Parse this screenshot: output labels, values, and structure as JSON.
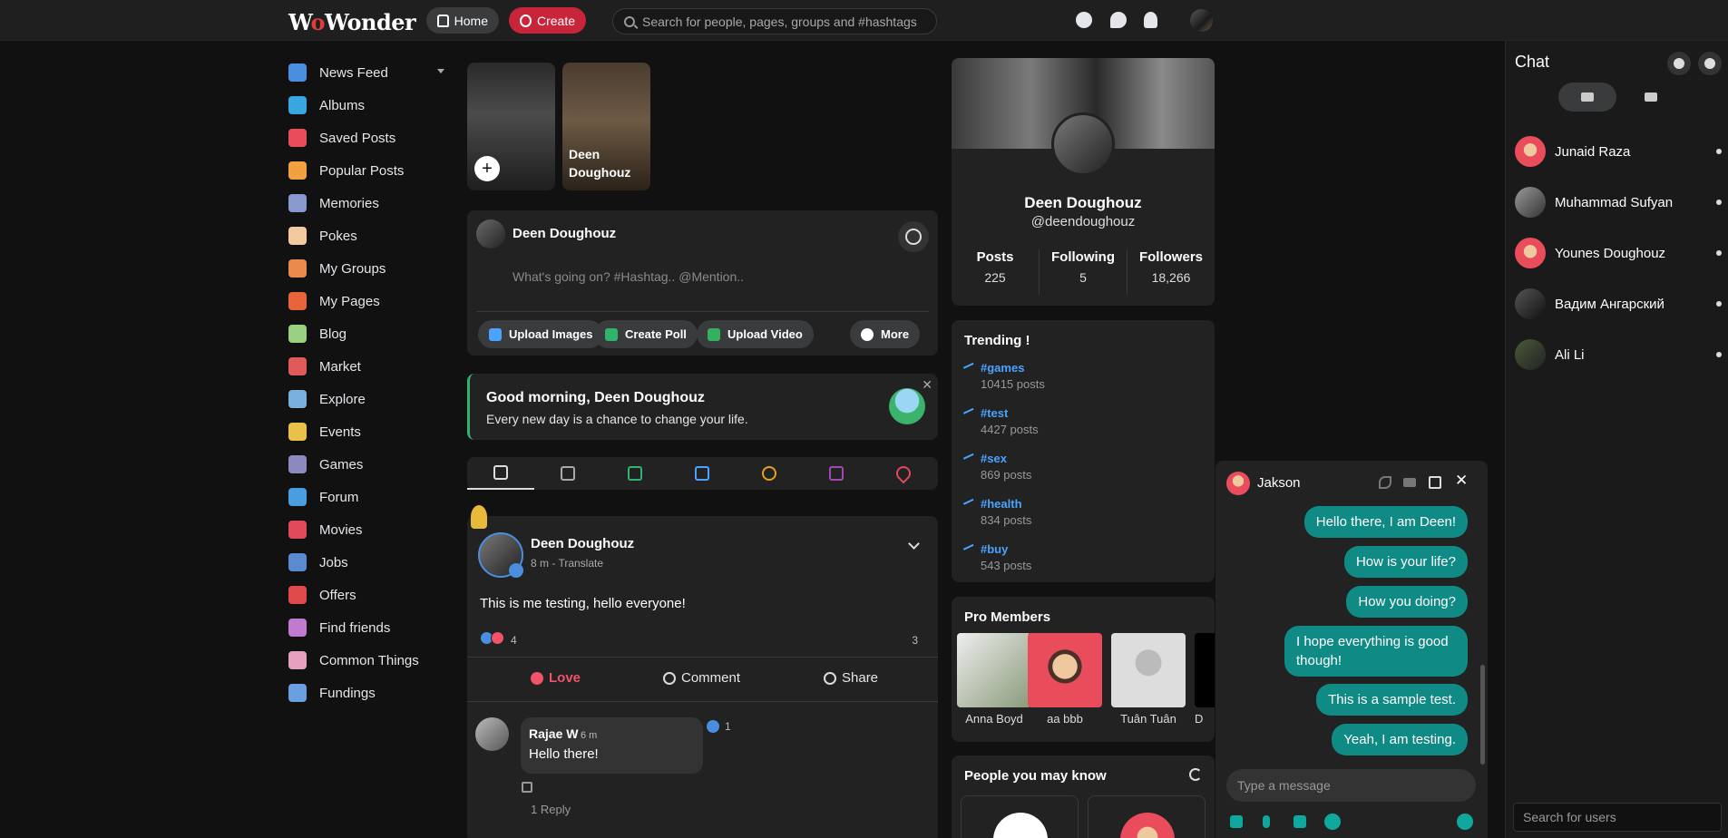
{
  "header": {
    "logo": "WoWonder",
    "home_label": "Home",
    "create_label": "Create",
    "search_placeholder": "Search for people, pages, groups and #hashtags"
  },
  "nav": {
    "items": [
      {
        "label": "News Feed",
        "icon": "home-icon",
        "color": "#4a8ee0"
      },
      {
        "label": "Albums",
        "icon": "albums-icon",
        "color": "#3aa6e0"
      },
      {
        "label": "Saved Posts",
        "icon": "bookmark-icon",
        "color": "#e94d5c"
      },
      {
        "label": "Popular Posts",
        "icon": "fire-icon",
        "color": "#f0a040"
      },
      {
        "label": "Memories",
        "icon": "memories-icon",
        "color": "#8a9ad0"
      },
      {
        "label": "Pokes",
        "icon": "poke-icon",
        "color": "#f3c9a0"
      },
      {
        "label": "My Groups",
        "icon": "groups-icon",
        "color": "#e88a4a"
      },
      {
        "label": "My Pages",
        "icon": "flag-icon",
        "color": "#e8643a"
      },
      {
        "label": "Blog",
        "icon": "blog-icon",
        "color": "#9ad080"
      },
      {
        "label": "Market",
        "icon": "market-icon",
        "color": "#e05a5a"
      },
      {
        "label": "Explore",
        "icon": "explore-icon",
        "color": "#7ab0e0"
      },
      {
        "label": "Events",
        "icon": "events-icon",
        "color": "#e8c04a"
      },
      {
        "label": "Games",
        "icon": "games-icon",
        "color": "#8a8ac0"
      },
      {
        "label": "Forum",
        "icon": "forum-icon",
        "color": "#4a9ee0"
      },
      {
        "label": "Movies",
        "icon": "movies-icon",
        "color": "#e04a5a"
      },
      {
        "label": "Jobs",
        "icon": "jobs-icon",
        "color": "#5a8ad0"
      },
      {
        "label": "Offers",
        "icon": "offers-icon",
        "color": "#e04a4a"
      },
      {
        "label": "Find friends",
        "icon": "find-friends-icon",
        "color": "#c07ad0"
      },
      {
        "label": "Common Things",
        "icon": "puzzle-icon",
        "color": "#e8a0c0"
      },
      {
        "label": "Fundings",
        "icon": "fundings-icon",
        "color": "#6aa0e0"
      }
    ]
  },
  "stories": {
    "second_name": "Deen Doughouz"
  },
  "composer": {
    "name": "Deen Doughouz",
    "placeholder": "What's going on? #Hashtag.. @Mention..",
    "upload_images": "Upload Images",
    "create_poll": "Create Poll",
    "upload_video": "Upload Video",
    "more": "More"
  },
  "greeting": {
    "title": "Good morning, Deen Doughouz",
    "subtitle": "Every new day is a chance to change your life."
  },
  "post": {
    "author": "Deen Doughouz",
    "meta": "8 m - Translate",
    "text": "This is me testing, hello everyone!",
    "reactions": "4",
    "comments": "3",
    "love": "Love",
    "comment": "Comment",
    "share": "Share",
    "comment_item": {
      "name": "Rajae W",
      "time": "6 m",
      "text": "Hello there!",
      "likes": "1",
      "reply": "1 Reply"
    }
  },
  "profile": {
    "name": "Deen Doughouz",
    "handle": "@deendoughouz",
    "stats": [
      {
        "label": "Posts",
        "value": "225"
      },
      {
        "label": "Following",
        "value": "5"
      },
      {
        "label": "Followers",
        "value": "18,266"
      }
    ]
  },
  "trending": {
    "title": "Trending !",
    "items": [
      {
        "tag": "#games",
        "count": "10415 posts"
      },
      {
        "tag": "#test",
        "count": "4427 posts"
      },
      {
        "tag": "#sex",
        "count": "869 posts"
      },
      {
        "tag": "#health",
        "count": "834 posts"
      },
      {
        "tag": "#buy",
        "count": "543 posts"
      }
    ]
  },
  "pro_members": {
    "title": "Pro Members",
    "members": [
      "Anna Boyd",
      "aa bbb",
      "Tuân Tuân",
      "D"
    ]
  },
  "pymk": {
    "title": "People you may know"
  },
  "chat": {
    "title": "Chat",
    "users": [
      {
        "name": "Junaid Raza"
      },
      {
        "name": "Muhammad Sufyan"
      },
      {
        "name": "Younes Doughouz"
      },
      {
        "name": "Вадим Ангарский"
      },
      {
        "name": "Ali Li"
      }
    ],
    "search_placeholder": "Search for users"
  },
  "chat_window": {
    "name": "Jakson",
    "messages": [
      "Hello there, I am Deen!",
      "How is your life?",
      "How you doing?",
      "I hope everything is good though!",
      "This is a sample test.",
      "Yeah, I am testing."
    ],
    "input_placeholder": "Type a message"
  }
}
